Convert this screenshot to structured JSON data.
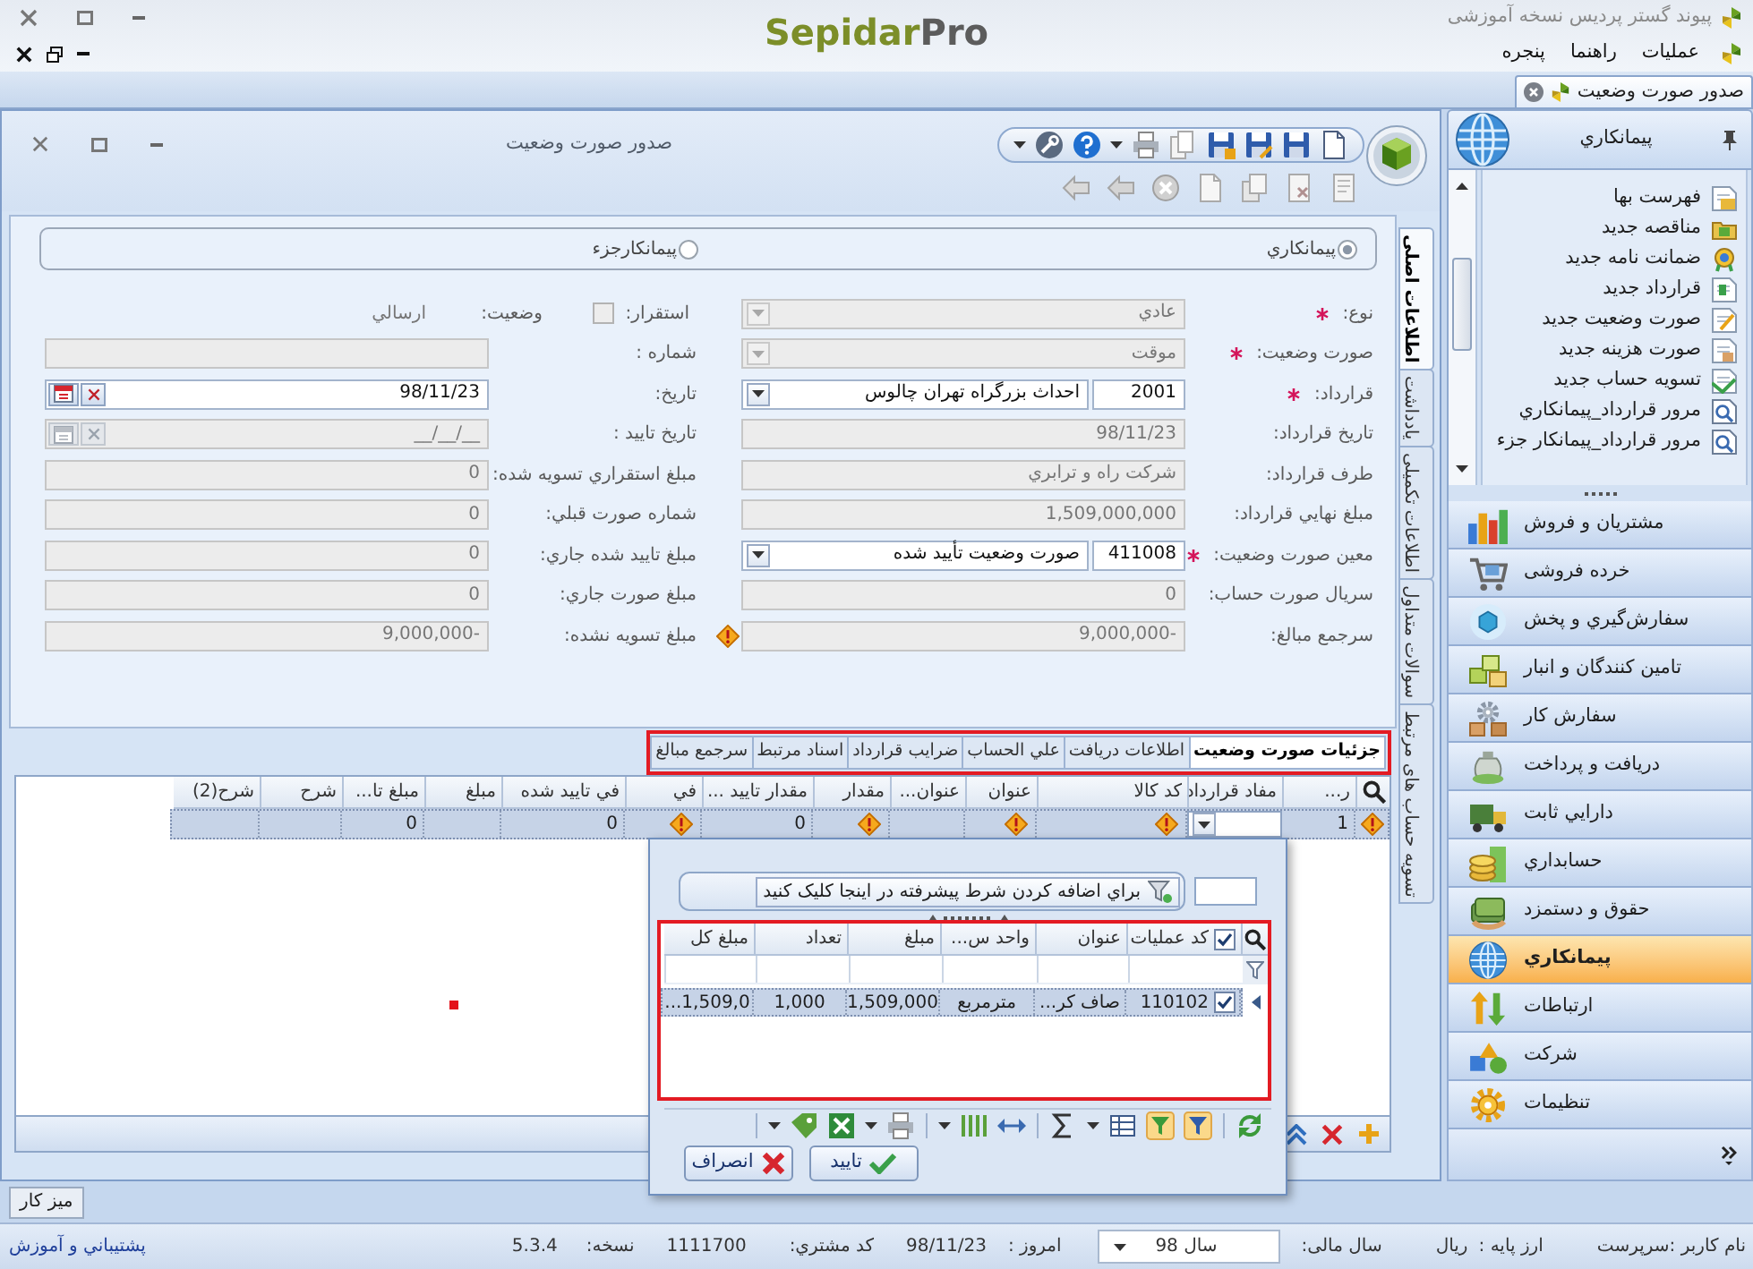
{
  "app_window": {
    "title": "پیوند گستر پردیس نسخه آموزشی",
    "logo": {
      "brand": "Sepidar",
      "suffix": "Pro"
    }
  },
  "menu_bar": {
    "items": [
      "عملیات",
      "راهنما",
      "پنجره"
    ]
  },
  "document_tabs": [
    {
      "label": "صدور صورت وضعیت",
      "selected": true
    }
  ],
  "form_window": {
    "title": "صدور صورت وضعیت",
    "side_tabs": [
      {
        "label": "اطلاعات اصلی",
        "selected": true
      },
      {
        "label": "یادداشت",
        "selected": false
      },
      {
        "label": "اطلاعات تکمیلی",
        "selected": false
      },
      {
        "label": "سوالات متداول",
        "selected": false
      },
      {
        "label": "تسویه حساب های مرتبط",
        "selected": false
      }
    ],
    "contractor_type": [
      {
        "label": "پیمانکاري",
        "selected": true
      },
      {
        "label": "پیمانکارجزء",
        "selected": false
      }
    ],
    "right_fields": [
      {
        "kind": "combo",
        "label": "نوع:",
        "required": true,
        "disabled": true,
        "warning": false,
        "value": "عادي"
      },
      {
        "kind": "combo",
        "label": "صورت وضعیت:",
        "required": true,
        "disabled": true,
        "warning": false,
        "value": "موقت"
      },
      {
        "kind": "lookup",
        "label": "قرارداد:",
        "required": true,
        "disabled": false,
        "warning": false,
        "code": "2001",
        "value": "احداث بزرگراه تهران چالوس"
      },
      {
        "kind": "text",
        "label": "تاریخ قرارداد:",
        "required": false,
        "disabled": true,
        "warning": false,
        "value": "98/11/23"
      },
      {
        "kind": "text",
        "label": "طرف قرارداد:",
        "required": false,
        "disabled": true,
        "warning": false,
        "value": "شرکت راه و ترابري"
      },
      {
        "kind": "text",
        "label": "مبلغ نهایي قرارداد:",
        "required": false,
        "disabled": true,
        "warning": false,
        "value": "1,509,000,000"
      },
      {
        "kind": "lookup",
        "label": "معین صورت وضعیت:",
        "required": true,
        "disabled": false,
        "warning": false,
        "code": "411008",
        "value": "صورت وضعیت تأیید شده"
      },
      {
        "kind": "text",
        "label": "سریال صورت حساب:",
        "required": false,
        "disabled": true,
        "warning": false,
        "value": "0"
      },
      {
        "kind": "text",
        "label": "سرجمع مبالغ:",
        "required": false,
        "disabled": true,
        "warning": true,
        "value": "9,000,000-"
      }
    ],
    "left_fields": [
      {
        "kind": "status",
        "label": "استقرار:",
        "checked": false,
        "disabled": true,
        "status_label": "وضعیت:",
        "status_value": "ارسالي"
      },
      {
        "kind": "text",
        "label": "شماره :",
        "disabled": true
      },
      {
        "kind": "date",
        "label": "تاریخ:",
        "disabled": false,
        "value": "98/11/23"
      },
      {
        "kind": "date",
        "label": "تاریخ تایید :",
        "disabled": true,
        "value": "__/__/__"
      },
      {
        "kind": "text",
        "label": "مبلغ استقراري تسویه شده:",
        "disabled": true,
        "value": "0"
      },
      {
        "kind": "text",
        "label": "شماره صورت  قبلي:",
        "disabled": true,
        "value": "0"
      },
      {
        "kind": "text",
        "label": "مبلغ  تایید شده جاري:",
        "disabled": true,
        "value": "0"
      },
      {
        "kind": "text",
        "label": "مبلغ صورت جاري:",
        "disabled": true,
        "value": "0"
      },
      {
        "kind": "text",
        "label": "مبلغ تسویه نشده:",
        "disabled": true,
        "value": "9,000,000-"
      }
    ],
    "detail_tabs": [
      {
        "label": "جزئیات صورت وضعیت",
        "selected": true
      },
      {
        "label": "اطلاعات دریافت",
        "selected": false
      },
      {
        "label": "علي الحساب",
        "selected": false
      },
      {
        "label": "ضرایب قرارداد",
        "selected": false
      },
      {
        "label": "اسناد مرتبط",
        "selected": false
      },
      {
        "label": "سرجمع مبالغ",
        "selected": false
      }
    ],
    "details_grid": {
      "columns": [
        "ر...",
        "مفاد قرارداد",
        "کد کالا",
        "عنوان",
        "عنوان...",
        "مقدار",
        "مقدار تایید ...",
        "في",
        "في تایید شده",
        "مبلغ",
        "مبلغ تا...",
        "شرح",
        "شرح(2)"
      ],
      "rows": [
        {
          "selected": true,
          "warning": true,
          "cells": [
            {
              "kind": "text",
              "value": "1"
            },
            {
              "kind": "dropdown"
            },
            {
              "kind": "warning"
            },
            {
              "kind": "warning"
            },
            {
              "kind": "blank"
            },
            {
              "kind": "warning"
            },
            {
              "kind": "text",
              "value": "0"
            },
            {
              "kind": "warning"
            },
            {
              "kind": "text",
              "value": "0"
            },
            {
              "kind": "blank"
            },
            {
              "kind": "text",
              "value": "0"
            },
            {
              "kind": "blank"
            },
            {
              "kind": "blank"
            }
          ]
        }
      ]
    }
  },
  "lookup_popup": {
    "filter_button": "براي اضافه کردن شرط پیشرفته در اینجا کلیک کنید",
    "grid": {
      "select_all_checked": true,
      "columns": [
        "کد عملیات",
        "عنوان",
        "واحد س...",
        "مبلغ",
        "تعداد",
        "مبلغ کل"
      ],
      "rows": [
        {
          "selected": true,
          "checked": true,
          "cells": [
            "110102",
            "صاف کر...",
            "مترمربع",
            "1,509,000",
            "1,000",
            "...1,509,0"
          ]
        }
      ]
    },
    "buttons": [
      {
        "kind": "ok",
        "label": "تایید"
      },
      {
        "kind": "cancel",
        "label": "انصراف"
      }
    ]
  },
  "sidebar": {
    "title": "پیمانکاري",
    "items": [
      "فهرست بها",
      "مناقصه جدید",
      "ضمانت نامه جدید",
      "قرارداد جدید",
      "صورت وضعیت جدید",
      "صورت هزینه جدید",
      "تسویه حساب جدید",
      "مرور قرارداد_پیمانکاري",
      "مرور قرارداد_پیمانکار جزء"
    ],
    "modules": [
      {
        "label": "مشتریان و فروش",
        "selected": false
      },
      {
        "label": "خرده فروشی",
        "selected": false
      },
      {
        "label": "سفارش‌گیري و پخش",
        "selected": false
      },
      {
        "label": "تامین کنندگان و انبار",
        "selected": false
      },
      {
        "label": "سفارش کار",
        "selected": false
      },
      {
        "label": "دریافت و پرداخت",
        "selected": false
      },
      {
        "label": "دارایي ثابت",
        "selected": false
      },
      {
        "label": "حسابداري",
        "selected": false
      },
      {
        "label": "حقوق و دستمزد",
        "selected": false
      },
      {
        "label": "پیمانکاري",
        "selected": true
      },
      {
        "label": "ارتباطات",
        "selected": false
      },
      {
        "label": "شرکت",
        "selected": false
      },
      {
        "label": "تنظیمات",
        "selected": false
      }
    ]
  },
  "workspace": {
    "desktop_button": "میز کار"
  },
  "status_bar": {
    "user": "نام کاربر :سرپرست",
    "currency_label": "ارز پایه :",
    "currency": "ریال",
    "fiscal_year_label": "سال مالی:",
    "fiscal_year": "سال 98",
    "today_label": "امروز :",
    "today": "98/11/23",
    "customer_code_label": "کد مشتري:",
    "customer_code": "1111700",
    "version_label": "نسخه:",
    "version": "5.3.4",
    "support_link": "پشتیباني و آموزش"
  }
}
